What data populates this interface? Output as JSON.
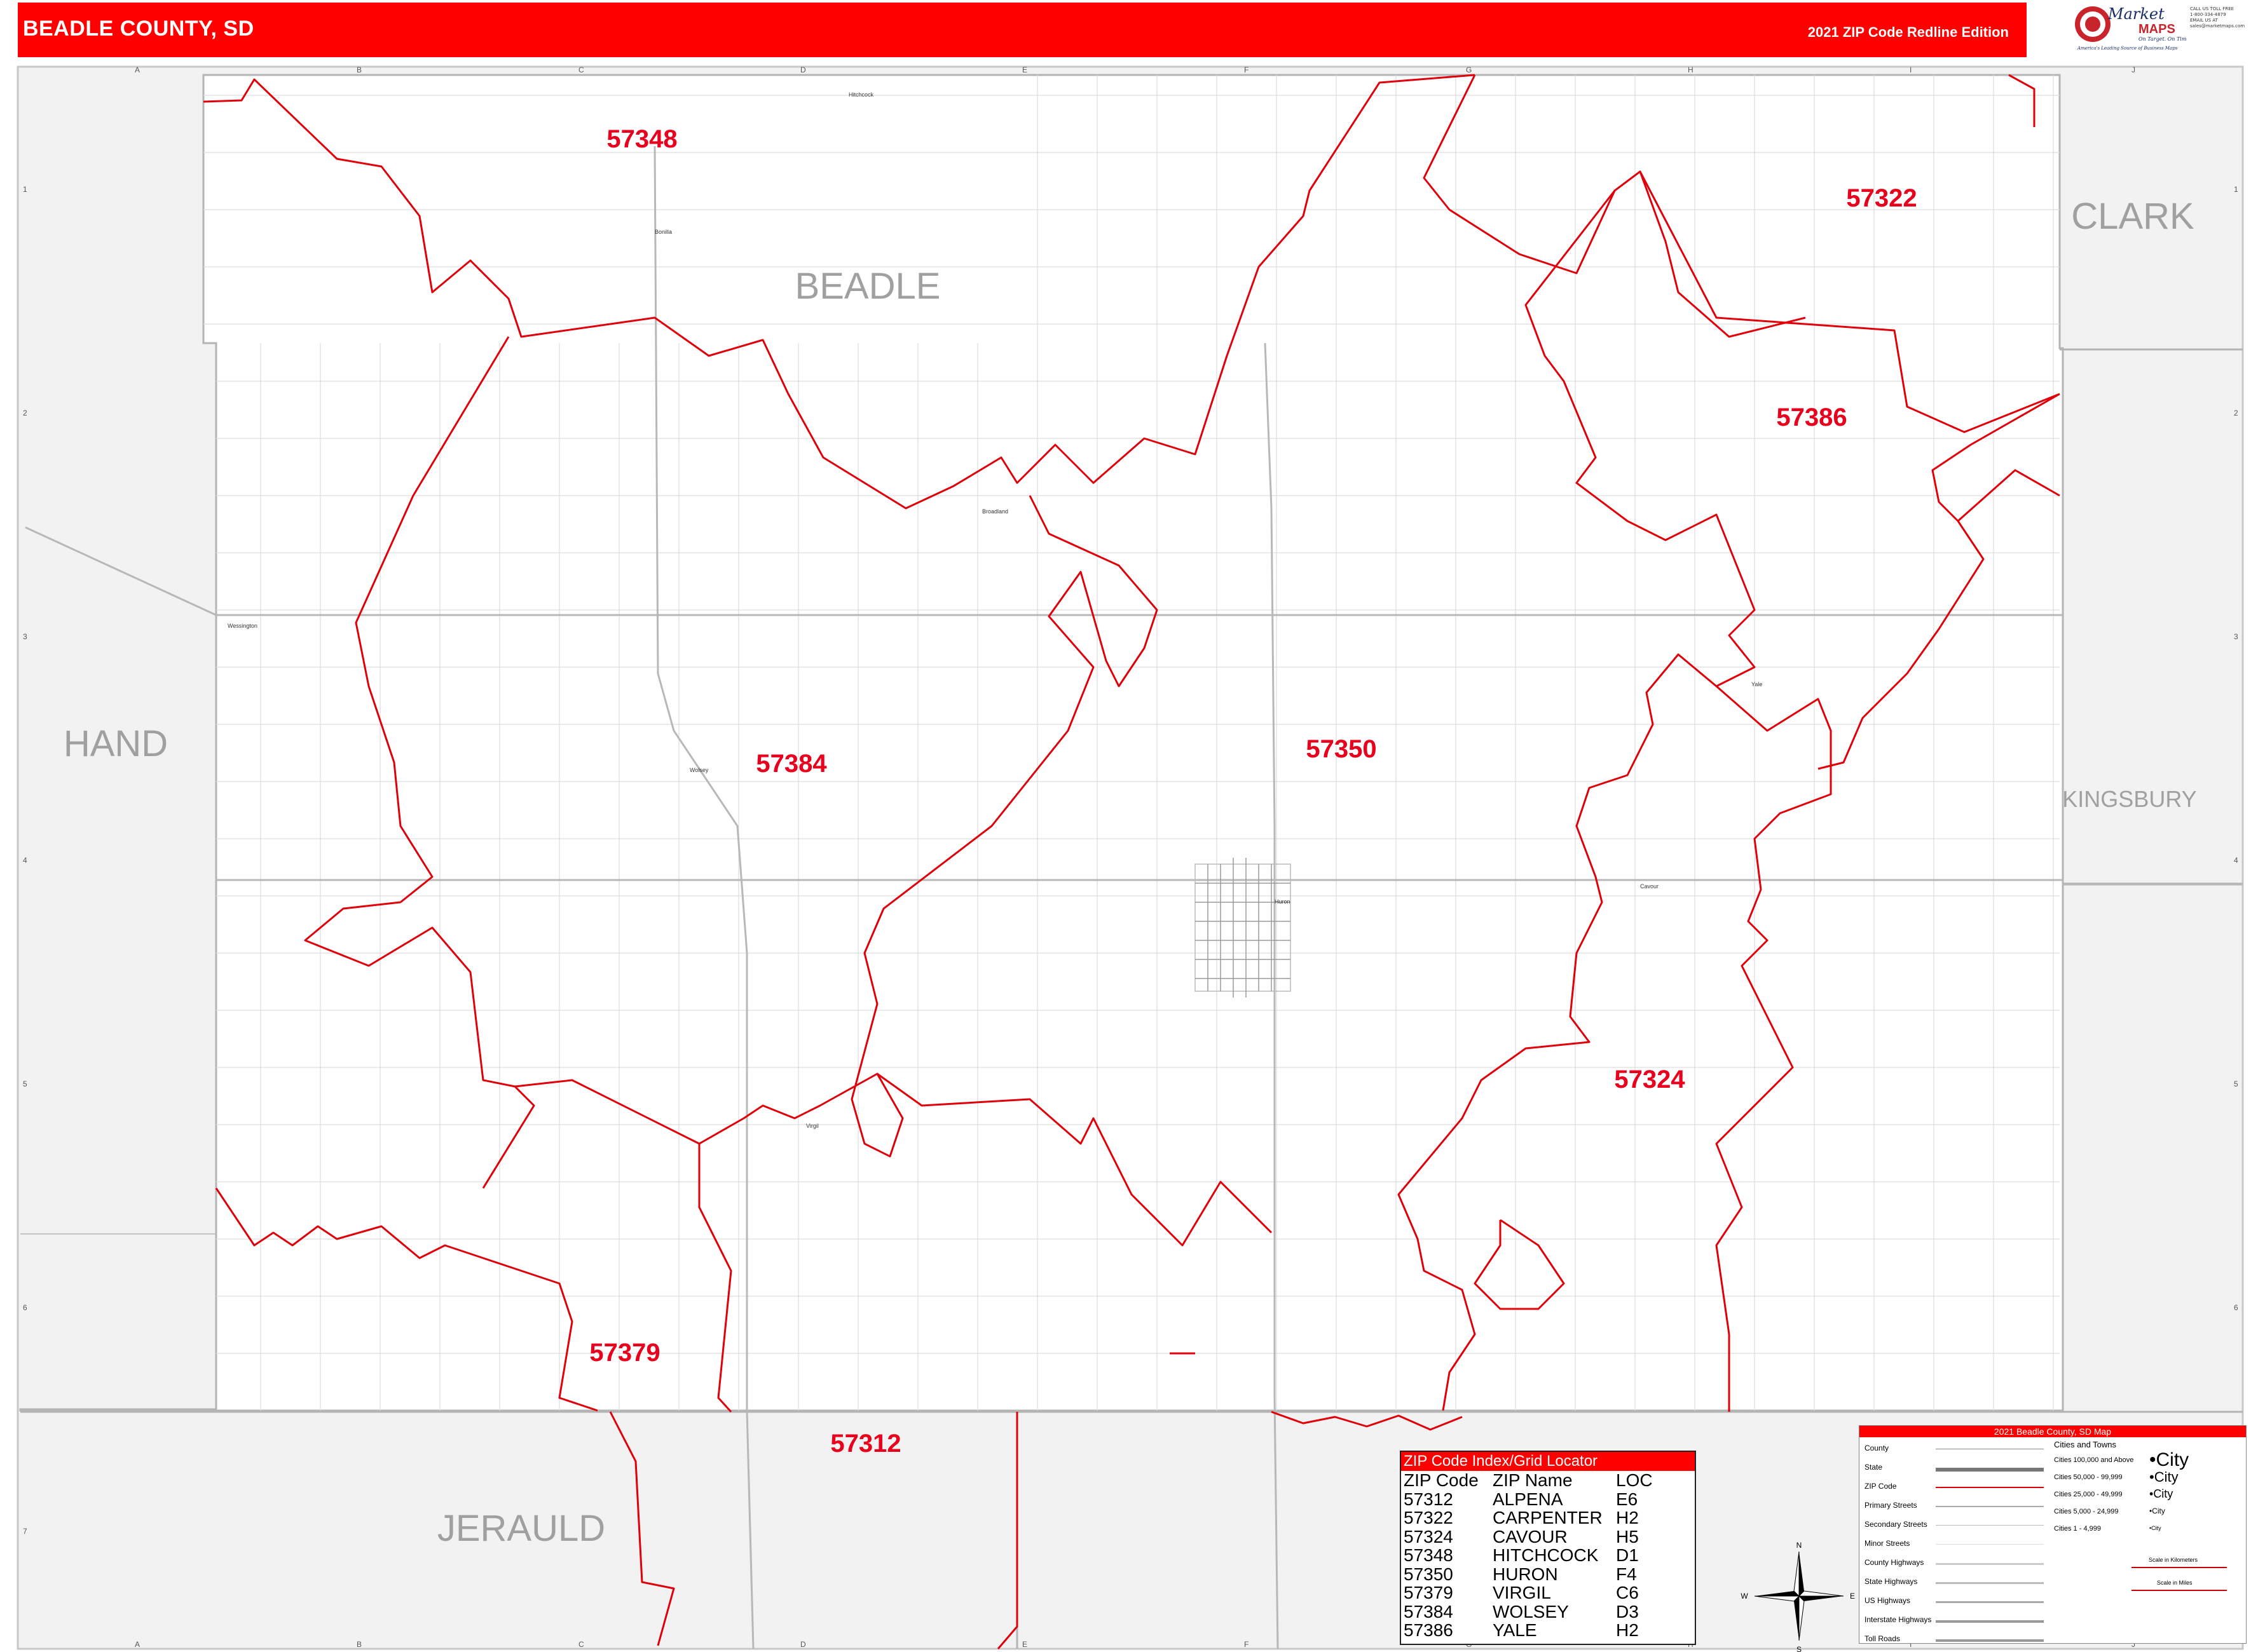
{
  "header": {
    "title": "BEADLE COUNTY, SD",
    "edition": "2021 ZIP Code Redline Edition"
  },
  "logo": {
    "word1": "Market",
    "word2": "MAPS",
    "tagline1": "On Target. On Time.",
    "tagline2": "America's Leading Source of Business Maps",
    "contact": [
      "CALL US TOLL FREE",
      "1-800-334-4879",
      "EMAIL US AT",
      "sales@marketmaps.com"
    ]
  },
  "colors": {
    "header": "#ff0000",
    "zip_boundary": "#e0000a",
    "zip_label": "#e8001c",
    "county_label": "#a0a0a0",
    "outside_county_fill": "#f2f2f2"
  },
  "grid": {
    "columns": [
      "A",
      "B",
      "C",
      "D",
      "E",
      "F",
      "G",
      "H",
      "I",
      "J"
    ],
    "rows": [
      "1",
      "2",
      "3",
      "4",
      "5",
      "6",
      "7"
    ]
  },
  "county_labels": {
    "beadle": "BEADLE",
    "clark": "CLARK",
    "hand": "HAND",
    "kingsbury": "KINGSBURY",
    "jerauld": "JERAULD"
  },
  "zip_labels": {
    "z57348": "57348",
    "z57322": "57322",
    "z57386": "57386",
    "z57384": "57384",
    "z57350": "57350",
    "z57324": "57324",
    "z57379": "57379",
    "z57312": "57312"
  },
  "towns": {
    "hitchcock": "Hitchcock",
    "bonilla": "Bonilla",
    "broadland": "Broadland",
    "wessington": "Wessington",
    "wolsey": "Wolsey",
    "huron": "Huron",
    "cavour": "Cavour",
    "yale": "Yale",
    "virgil": "Virgil"
  },
  "zip_index": {
    "title": "ZIP Code Index/Grid Locator",
    "headers": [
      "ZIP Code",
      "ZIP Name",
      "LOC"
    ],
    "rows": [
      [
        "57312",
        "ALPENA",
        "E6"
      ],
      [
        "57322",
        "CARPENTER",
        "H2"
      ],
      [
        "57324",
        "CAVOUR",
        "H5"
      ],
      [
        "57348",
        "HITCHCOCK",
        "D1"
      ],
      [
        "57350",
        "HURON",
        "F4"
      ],
      [
        "57379",
        "VIRGIL",
        "C6"
      ],
      [
        "57384",
        "WOLSEY",
        "D3"
      ],
      [
        "57386",
        "YALE",
        "H2"
      ]
    ]
  },
  "map_legend": {
    "title": "2021 Beadle County, SD Map",
    "items": [
      "County",
      "State",
      "ZIP Code",
      "Primary Streets",
      "Secondary Streets",
      "Minor Streets",
      "County Highways",
      "State Highways",
      "US Highways",
      "Interstate Highways",
      "Toll Roads"
    ],
    "cities_title": "Cities and Towns",
    "city_classes": [
      "Cities 100,000 and Above",
      "Cities 50,000 - 99,999",
      "Cities 25,000 - 49,999",
      "Cities 5,000 - 24,999",
      "Cities 1 - 4,999"
    ],
    "city_samples": [
      "City",
      "City",
      "City",
      "City",
      "City"
    ],
    "scale_km": "Scale in Kilometers",
    "scale_mi": "Scale in Miles"
  },
  "compass": {
    "n": "N",
    "s": "S",
    "e": "E",
    "w": "W"
  }
}
